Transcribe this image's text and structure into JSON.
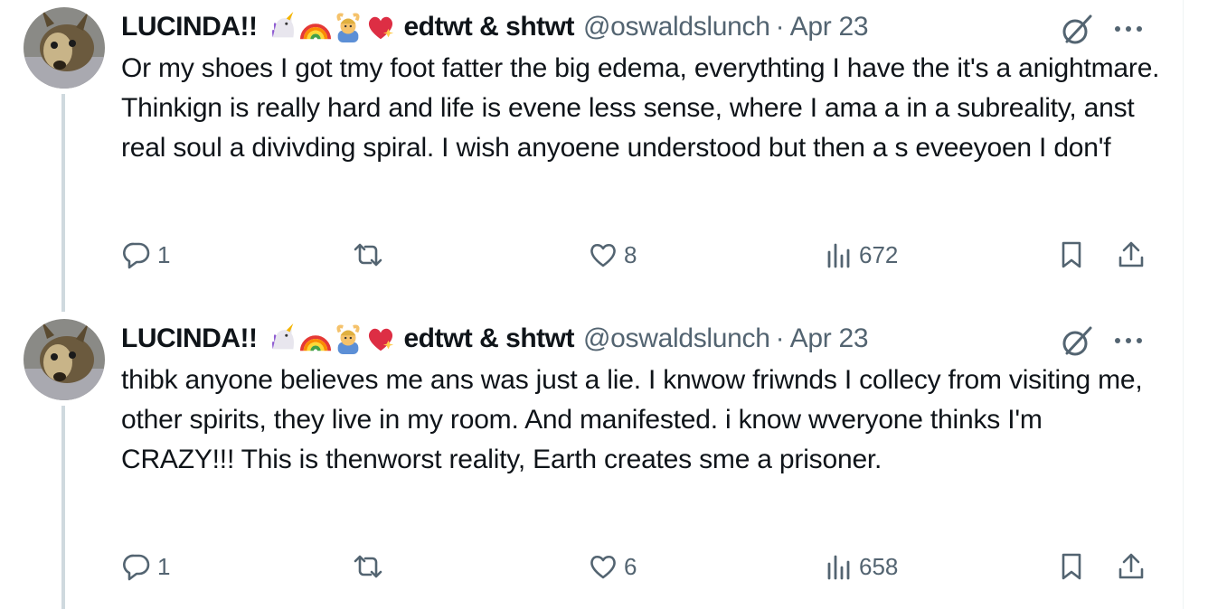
{
  "tweets": [
    {
      "display_name": "LUCINDA!!",
      "emoji_suffix": "edtwt & shtwt",
      "handle": "@oswaldslunch",
      "separator": "·",
      "date": "Apr 23",
      "text": "Or my shoes I got tmy foot fatter the big edema, everythting I have the  it's a anightmare. Thinkign is really hard and life is evene less sense, where I ama a in a subreality, anst real soul a divivding spiral. I wish anyoene understood but then a s eveeyoen I don'f",
      "replies": "1",
      "retweets": "",
      "likes": "8",
      "views": "672"
    },
    {
      "display_name": "LUCINDA!!",
      "emoji_suffix": "edtwt & shtwt",
      "handle": "@oswaldslunch",
      "separator": "·",
      "date": "Apr 23",
      "text": "thibk anyone believes me ans was just a lie. I knwow friwnds I collecy from visiting me, other spirits, they live in my room. And manifested. i know wveryone thinks I'm CRAZY!!! This is thenworst reality, Earth creates sme a prisoner.",
      "replies": "1",
      "retweets": "",
      "likes": "6",
      "views": "658"
    }
  ],
  "icons": {
    "name_emojis": [
      "unicorn-emoji",
      "rainbow-emoji",
      "person-gesturing-ok-emoji",
      "sparkling-heart-emoji"
    ],
    "actions": [
      "reply-icon",
      "retweet-icon",
      "like-icon",
      "views-icon",
      "bookmark-icon",
      "share-icon"
    ],
    "header": [
      "grok-icon",
      "more-icon"
    ]
  },
  "colors": {
    "text": "#0f1419",
    "secondary": "#536471",
    "thread_line": "#cfd9de"
  }
}
